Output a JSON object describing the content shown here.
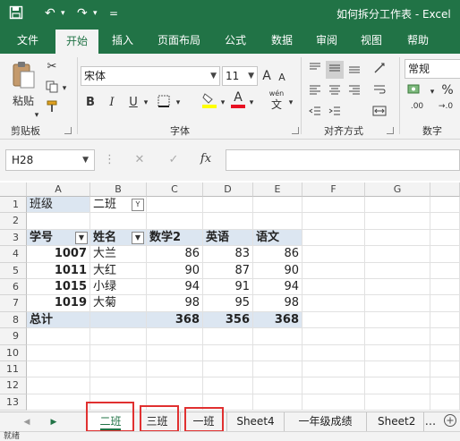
{
  "window": {
    "title": "如何拆分工作表 - Excel"
  },
  "ribbon_tabs": [
    "文件",
    "开始",
    "插入",
    "页面布局",
    "公式",
    "数据",
    "审阅",
    "视图",
    "帮助"
  ],
  "active_ribbon_tab": "开始",
  "clipboard": {
    "paste_label": "粘贴",
    "group_label": "剪贴板"
  },
  "font": {
    "name": "宋体",
    "size": "11",
    "bold": "B",
    "italic": "I",
    "underline": "U",
    "grow": "A",
    "shrink": "A",
    "color_letter": "A",
    "phonetic_top": "wén",
    "phonetic_bottom": "文",
    "group_label": "字体"
  },
  "alignment": {
    "group_label": "对齐方式"
  },
  "number": {
    "format": "常规",
    "percent": "%",
    "group_label": "数字",
    "dec_inc": ".00",
    "dec_dec": "→.0"
  },
  "formula_bar": {
    "name_box": "H28",
    "fx_label": "fx",
    "cancel": "✕",
    "enter": "✓",
    "value": ""
  },
  "columns": [
    "A",
    "B",
    "C",
    "D",
    "E",
    "F",
    "G"
  ],
  "rows": [
    "1",
    "2",
    "3",
    "4",
    "5",
    "6",
    "7",
    "8",
    "9",
    "10",
    "11",
    "12",
    "13"
  ],
  "pivot": {
    "filter_label": "班级",
    "filter_value": "二班",
    "headers": [
      "学号",
      "姓名",
      "数学2",
      "英语",
      "语文"
    ],
    "records": [
      {
        "id": "1007",
        "name": "大兰",
        "math": "86",
        "english": "83",
        "chinese": "86"
      },
      {
        "id": "1011",
        "name": "大红",
        "math": "90",
        "english": "87",
        "chinese": "90"
      },
      {
        "id": "1015",
        "name": "小绿",
        "math": "94",
        "english": "91",
        "chinese": "94"
      },
      {
        "id": "1019",
        "name": "大菊",
        "math": "98",
        "english": "95",
        "chinese": "98"
      }
    ],
    "total": {
      "label": "总计",
      "math": "368",
      "english": "356",
      "chinese": "368"
    }
  },
  "sheet_tabs": [
    "二班",
    "三班",
    "一班",
    "Sheet4",
    "一年级成绩",
    "Sheet2"
  ],
  "active_sheet": "二班",
  "more_tabs": "...",
  "status": "就绪",
  "colors": {
    "accent": "#217346",
    "highlight_box": "#e03030",
    "pivot_fill": "#dce6f1",
    "font_color_bar": "#e81123",
    "fill_color_bar": "#ffff00"
  }
}
